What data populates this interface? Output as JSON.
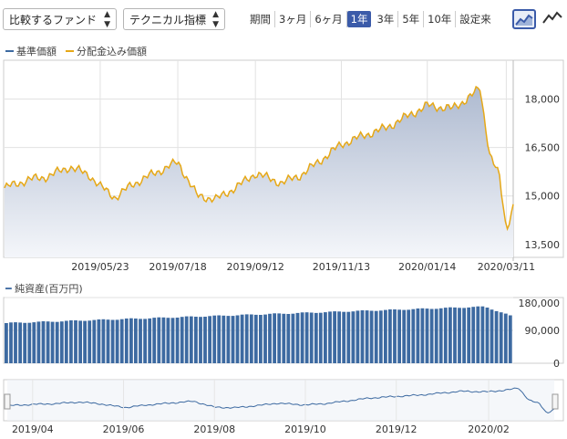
{
  "toolbar": {
    "compare_label": "比較するファンド",
    "technical_label": "テクニカル指標",
    "periods": [
      "期間",
      "3ヶ月",
      "6ヶ月",
      "1年",
      "3年",
      "5年",
      "10年",
      "設定来"
    ],
    "active_period": "1年"
  },
  "legend": {
    "base_price": "基準価額",
    "dividend_price": "分配金込み価額"
  },
  "colors": {
    "base": "#3d6aa1",
    "dividend": "#e6a817",
    "accent": "#3b5ba9"
  },
  "icons": [
    "area-chart-icon",
    "line-chart-icon"
  ],
  "chart_data": [
    {
      "type": "area",
      "series": [
        {
          "name": "基準価額"
        },
        {
          "name": "分配金込み価額"
        }
      ],
      "x": [
        "2019/03/15",
        "2019/04/01",
        "2019/04/15",
        "2019/05/01",
        "2019/05/15",
        "2019/05/23",
        "2019/06/03",
        "2019/06/15",
        "2019/07/01",
        "2019/07/18",
        "2019/08/01",
        "2019/08/15",
        "2019/09/01",
        "2019/09/12",
        "2019/10/01",
        "2019/10/15",
        "2019/11/01",
        "2019/11/13",
        "2019/12/01",
        "2019/12/15",
        "2020/01/01",
        "2020/01/14",
        "2020/02/01",
        "2020/02/15",
        "2020/02/21",
        "2020/02/28",
        "2020/03/06",
        "2020/03/11",
        "2020/03/16"
      ],
      "values": [
        15250,
        15500,
        15600,
        15900,
        15650,
        15300,
        14950,
        15350,
        15700,
        16050,
        15000,
        14900,
        15350,
        15700,
        15400,
        15650,
        16200,
        16600,
        16900,
        17100,
        17500,
        17800,
        17700,
        18100,
        18350,
        16300,
        15600,
        13950,
        14700
      ],
      "x_ticks": [
        "2019/05/23",
        "2019/07/18",
        "2019/09/12",
        "2019/11/13",
        "2020/01/14",
        "2020/03/11"
      ],
      "y_ticks": [
        "18,000",
        "16,500",
        "15,000",
        "13,500"
      ],
      "ylim": [
        13100,
        19200
      ]
    },
    {
      "type": "bar",
      "title": "純資産(百万円)",
      "y_ticks": [
        "180,000",
        "90,000",
        "0"
      ],
      "ylim": [
        0,
        180000
      ],
      "start_value": 110000,
      "peak_value": 155000
    },
    {
      "type": "line",
      "x_ticks": [
        "2019/04",
        "2019/06",
        "2019/08",
        "2019/10",
        "2019/12",
        "2020/02"
      ]
    }
  ]
}
